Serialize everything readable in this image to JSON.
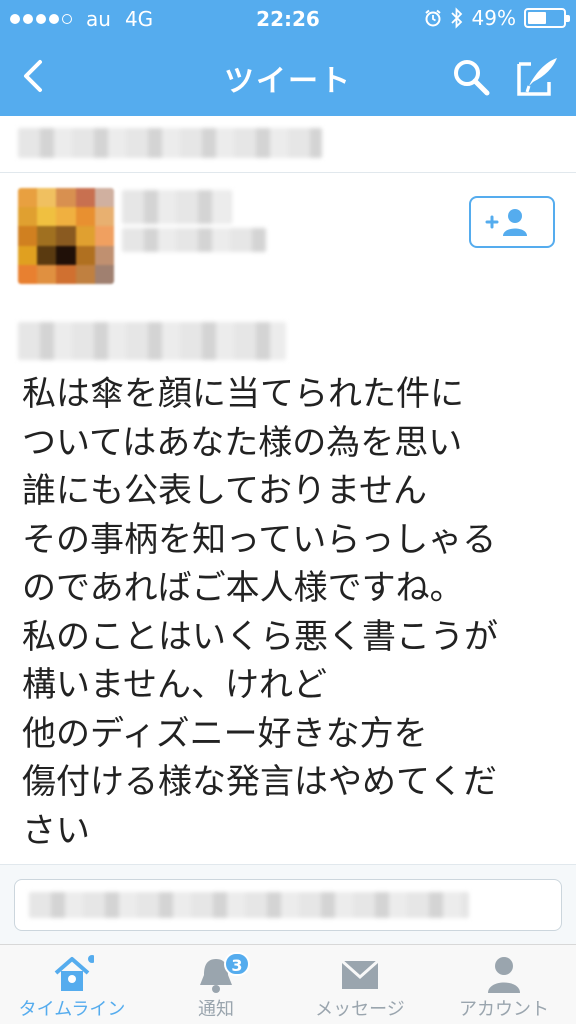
{
  "status_bar": {
    "carrier": "au",
    "network": "4G",
    "time": "22:26",
    "battery_percent": "49%",
    "battery_level": 0.49,
    "signal_bars_filled": 4,
    "signal_bars_total": 5
  },
  "nav": {
    "title": "ツイート",
    "back_icon": "chevron-left-icon",
    "search_icon": "search-icon",
    "compose_icon": "compose-tweet-icon"
  },
  "tweet": {
    "lines": [
      "私は傘を顔に当てられた件に",
      "ついてはあなた様の為を思い",
      "誰にも公表しておりません",
      "その事柄を知っていらっしゃる",
      "のであればご本人様ですね。",
      "私のことはいくら悪く書こうが",
      "構いません、けれど",
      "他のディズニー好きな方を",
      "傷付ける様な発言はやめてくだ",
      "さい"
    ]
  },
  "tabs": [
    {
      "label": "タイムライン",
      "icon": "home-icon",
      "active": true
    },
    {
      "label": "通知",
      "icon": "bell-icon",
      "badge": "3"
    },
    {
      "label": "メッセージ",
      "icon": "envelope-icon"
    },
    {
      "label": "アカウント",
      "icon": "person-icon"
    }
  ],
  "colors": {
    "accent": "#55acee",
    "inactive": "#9aa5ae"
  }
}
